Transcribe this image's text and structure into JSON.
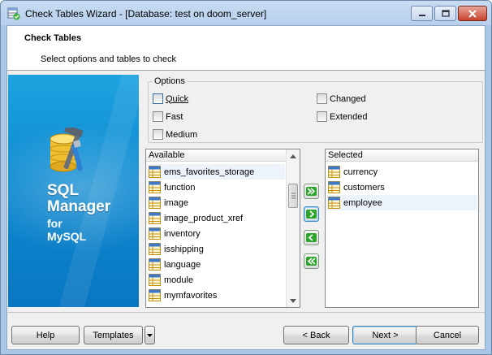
{
  "window": {
    "title": "Check Tables Wizard - [Database: test on doom_server]"
  },
  "header": {
    "title": "Check Tables",
    "subtitle": "Select options and tables to check"
  },
  "banner": {
    "line1": "SQL",
    "line2": "Manager",
    "line3": "for",
    "line4": "MySQL",
    "colors": {
      "top": "#1fa3e0",
      "bottom": "#0a76c2"
    }
  },
  "options": {
    "legend": "Options",
    "quick": "Quick",
    "fast": "Fast",
    "medium": "Medium",
    "changed": "Changed",
    "extended": "Extended"
  },
  "available": {
    "header": "Available",
    "items": [
      "ems_favorites_storage",
      "function",
      "image",
      "image_product_xref",
      "inventory",
      "isshipping",
      "language",
      "module",
      "mymfavorites"
    ]
  },
  "selected": {
    "header": "Selected",
    "items": [
      "currency",
      "customers",
      "employee"
    ]
  },
  "move_buttons": [
    {
      "name": "move-all-right-button",
      "icon": "double-right-arrow-icon"
    },
    {
      "name": "move-right-button",
      "icon": "right-arrow-icon"
    },
    {
      "name": "move-left-button",
      "icon": "left-arrow-icon"
    },
    {
      "name": "move-all-left-button",
      "icon": "double-left-arrow-icon"
    }
  ],
  "footer": {
    "help": "Help",
    "templates": "Templates",
    "back": "< Back",
    "next": "Next >",
    "cancel": "Cancel"
  }
}
